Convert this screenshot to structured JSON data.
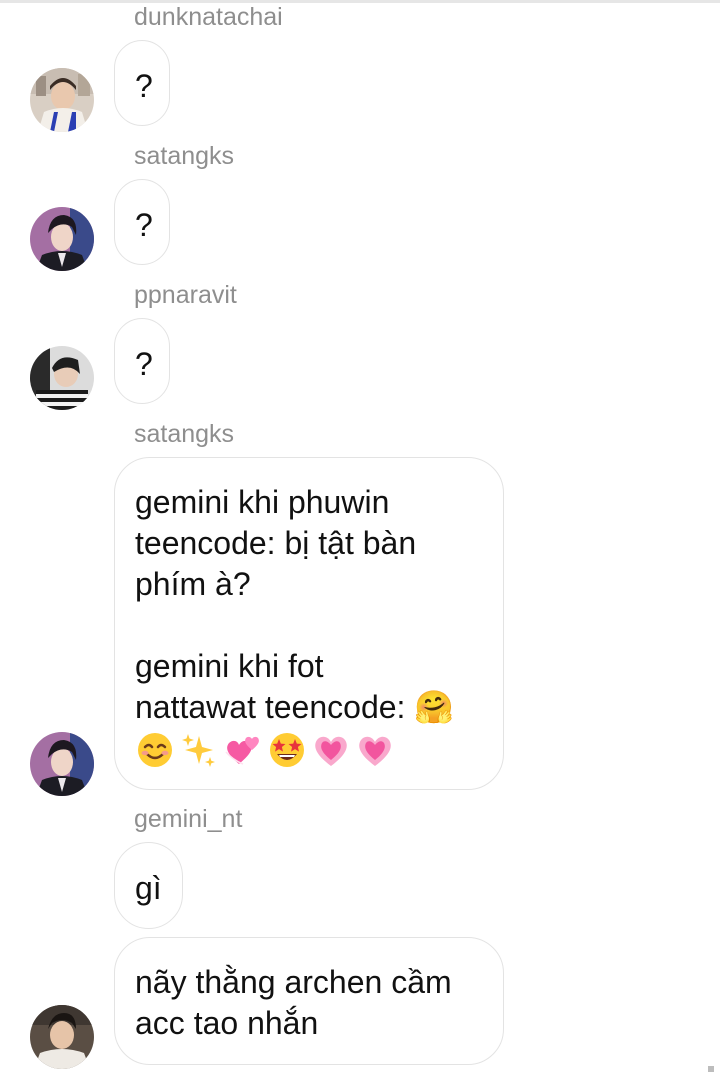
{
  "messages": [
    {
      "sender": "dunknatachai",
      "text": "?"
    },
    {
      "sender": "satangks",
      "text": "?"
    },
    {
      "sender": "ppnaravit",
      "text": "?"
    },
    {
      "sender": "satangks",
      "text": "gemini khi phuwin\nteencode: bị tật bàn\nphím à?\n\ngemini khi fot\nnattawat teencode: 🤗",
      "emojis": [
        "smiling-face-icon",
        "sparkles-icon",
        "two-hearts-icon",
        "star-struck-icon",
        "growing-heart-icon",
        "growing-heart-icon"
      ]
    },
    {
      "sender": "gemini_nt",
      "text": "gì"
    },
    {
      "sender": "",
      "text": "nãy thằng archen cầm\nacc tao nhắn"
    }
  ]
}
